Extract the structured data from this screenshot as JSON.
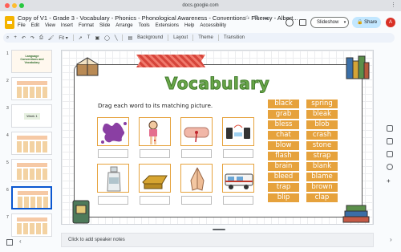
{
  "browser": {
    "url": "docs.google.com"
  },
  "app": {
    "doc_title": "Copy of V1 - Grade 3 - Vocabulary - Phonics - Phonological Awareness - Conventions - Fluency - Albert...",
    "menu": [
      "File",
      "Edit",
      "View",
      "Insert",
      "Format",
      "Slide",
      "Arrange",
      "Tools",
      "Extensions",
      "Help",
      "Accessibility"
    ],
    "slideshow_label": "Slideshow",
    "share_label": "Share",
    "avatar_initial": "A",
    "toolbar": {
      "zoom": "Fit",
      "buttons": [
        "Background",
        "Layout",
        "Theme",
        "Transition"
      ]
    }
  },
  "filmstrip": {
    "slide_numbers": [
      "1",
      "2",
      "3",
      "4",
      "5",
      "6",
      "7"
    ],
    "active": 6,
    "thumb1_text": "Language Conventions and Vocabulary",
    "thumb3_text": "Week 1"
  },
  "slide": {
    "title": "Vocabulary",
    "instruction": "Drag each word to its matching picture.",
    "words_left": [
      "black",
      "grab",
      "bless",
      "chat",
      "blow",
      "flash",
      "brain",
      "bleed",
      "trap",
      "blip"
    ],
    "words_right": [
      "spring",
      "bleak",
      "blob",
      "crash",
      "stone",
      "strap",
      "blank",
      "blame",
      "brown",
      "clap"
    ],
    "pictures": [
      "paint-splat",
      "girl-scraped-knee",
      "hand-with-wound",
      "phone-chat",
      "bottle",
      "stack-of-gold-bars",
      "praying-hands",
      "camper-van"
    ]
  },
  "notes": {
    "placeholder": "Click to add speaker notes"
  },
  "colors": {
    "title_green": "#6aa74a",
    "word_tile": "#e6a23c",
    "accent_blue": "#0b57d0",
    "share_bg": "#c2e7ff"
  }
}
